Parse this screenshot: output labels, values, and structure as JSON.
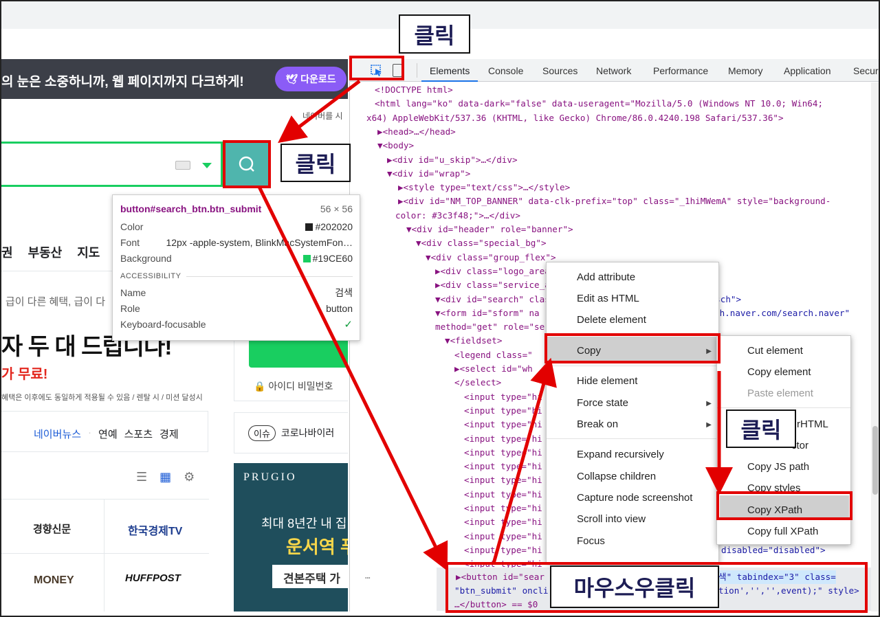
{
  "banner": {
    "text_pre": "의 눈은 소중하니까, 웹 ",
    "text_bold": "페이지까지 다크하게!",
    "download": "다운로드"
  },
  "naver": {
    "top_right": "네이버를 시",
    "nav": [
      "권",
      "부동산",
      "지도"
    ],
    "promo_line": "급이 다른 혜택, 급이 다",
    "headline": "자 두 대 드립니다!",
    "free": "가 무료!",
    "fine_print": "혜택은 이후에도 동일하게 적용될 수 있음 / 렌탈 시 / 미션 달성시",
    "news_links": {
      "naver_news": "네이버뉴스",
      "items": [
        "연예",
        "스포츠",
        "경제"
      ]
    },
    "issue": {
      "badge": "이슈",
      "text": "코로나바이러"
    },
    "login": {
      "id": "아이디",
      "pw": "비밀번호"
    },
    "press": [
      "경향신문",
      "한국경제TV",
      "MONEY",
      "HUFFPOST"
    ],
    "ad": {
      "brand": "PRUGIO",
      "line1": "최대 8년간 내 집",
      "line2": "운서역 푸",
      "btn": "견본주택 가"
    }
  },
  "tooltip": {
    "selector": "button#search_btn.btn_submit",
    "size": "56 × 56",
    "rows": [
      {
        "k": "Color",
        "v": "#202020",
        "swatch": "#202020"
      },
      {
        "k": "Font",
        "v": "12px -apple-system, BlinkMacSystemFon…"
      },
      {
        "k": "Background",
        "v": "#19CE60",
        "swatch": "#19CE60"
      }
    ],
    "section": "ACCESSIBILITY",
    "acc": [
      {
        "k": "Name",
        "v": "검색"
      },
      {
        "k": "Role",
        "v": "button"
      },
      {
        "k": "Keyboard-focusable",
        "v": ""
      }
    ]
  },
  "devtools": {
    "tabs": [
      "Elements",
      "Console",
      "Sources",
      "Network",
      "Performance",
      "Memory",
      "Application",
      "Securi"
    ],
    "lines": [
      "<!DOCTYPE html>",
      "<html lang=\"ko\" data-dark=\"false\" data-useragent=\"Mozilla/5.0 (Windows NT 10.0; Win64;",
      "x64) AppleWebKit/537.36 (KHTML, like Gecko) Chrome/86.0.4240.198 Safari/537.36\">",
      "▶<head>…</head>",
      "▼<body>",
      "▶<div id=\"u_skip\">…</div>",
      "▼<div id=\"wrap\">",
      "▶<style type=\"text/css\">…</style>",
      "▶<div id=\"NM_TOP_BANNER\" data-clk-prefix=\"top\" class=\"_1hiMWemA\" style=\"background-",
      "color: #3c3f48;\">…</div>",
      "▼<div id=\"header\" role=\"banner\">",
      "▼<div class=\"special_bg\">",
      "▼<div class=\"group_flex\">",
      "▶<div class=\"logo_area",
      "▶<div class=\"service_a",
      "▼<div id=\"search\" clas",
      "▼<form id=\"sform\" na",
      "method=\"get\" role=\"se",
      "▼<fieldset>",
      "<legend class=\"",
      "▶<select id=\"wh",
      "</select>",
      "<input type=\"hi",
      "<input type=\"hi",
      "<input type=\"hi",
      "<input type=\"hi",
      "<input type=\"hi",
      "<input type=\"hi",
      "<input type=\"hi",
      "<input type=\"hi",
      "<input type=\"hi",
      "<input type=\"hi",
      "<input type=\"hi",
      "<input type=\"hi",
      "<input type=\"hi",
      "▶<div cl"
    ],
    "right_fragments": {
      "sch": "=\"sch\">",
      "action": "ch.naver.com/search.naver\"",
      "disabled": "disabled=\"disabled\">"
    },
    "selected_line1": "▶<button id=\"sear",
    "selected_line1_tail": "색\" tabindex=\"3\" class=",
    "selected_line2": "\"btn_submit\" oncli",
    "selected_line2_tail": "tion','','',event);\" style>",
    "selected_line3": "…</button> == $0"
  },
  "context_menu": {
    "items": [
      "Add attribute",
      "Edit as HTML",
      "Delete element",
      "Copy",
      "Hide element",
      "Force state",
      "Break on",
      "Expand recursively",
      "Collapse children",
      "Capture node screenshot",
      "Scroll into view",
      "Focus"
    ]
  },
  "copy_submenu": {
    "items": [
      "Cut element",
      "Copy element",
      "Paste element",
      "Copy outerHTML",
      "Copy selector",
      "Copy JS path",
      "Copy styles",
      "Copy XPath",
      "Copy full XPath"
    ],
    "visible_items": {
      "outer": "rHTML",
      "sel": "ctor"
    }
  },
  "annotations": {
    "click": "클릭",
    "right_click": "마우스우클릭"
  }
}
